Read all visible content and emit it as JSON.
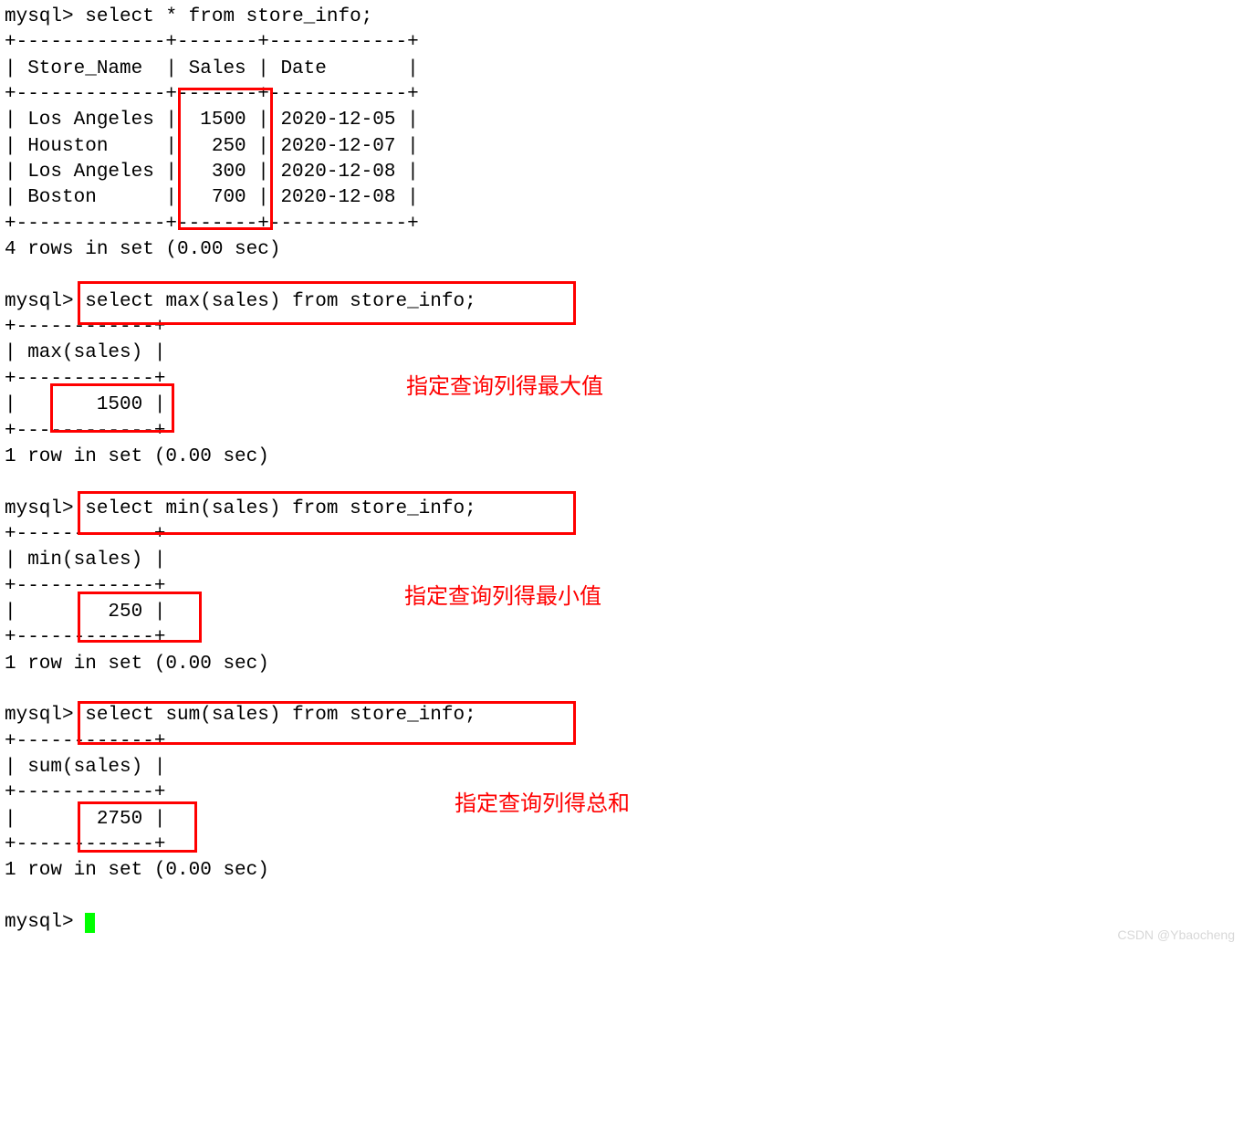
{
  "terminal": {
    "prompt": "mysql>",
    "query1": " select * from store_info;",
    "table1_border_top": "+-------------+-------+------------+",
    "table1_header": "| Store_Name  | Sales | Date       |",
    "table1_border_mid": "+-------------+-------+------------+",
    "table1_row1": "| Los Angeles |  1500 | 2020-12-05 |",
    "table1_row2": "| Houston     |   250 | 2020-12-07 |",
    "table1_row3": "| Los Angeles |   300 | 2020-12-08 |",
    "table1_row4": "| Boston      |   700 | 2020-12-08 |",
    "table1_border_bot": "+-------------+-------+------------+",
    "result1": "4 rows in set (0.00 sec)",
    "blank": "",
    "query2": " select max(sales) from store_info;",
    "table2_border_top": "+------------+",
    "table2_header": "| max(sales) |",
    "table2_border_mid": "+------------+",
    "table2_row1": "|       1500 |",
    "table2_border_bot": "+------------+",
    "result2": "1 row in set (0.00 sec)",
    "query3": " select min(sales) from store_info;",
    "table3_border_top": "+------------+",
    "table3_header": "| min(sales) |",
    "table3_border_mid": "+------------+",
    "table3_row1": "|        250 |",
    "table3_border_bot": "+------------+",
    "result3": "1 row in set (0.00 sec)",
    "query4": " select sum(sales) from store_info;",
    "table4_border_top": "+------------+",
    "table4_header": "| sum(sales) |",
    "table4_border_mid": "+------------+",
    "table4_row1": "|       2750 |",
    "table4_border_bot": "+------------+",
    "result4": "1 row in set (0.00 sec)",
    "final_prompt": "mysql> "
  },
  "annotations": {
    "label_max": "指定查询列得最大值",
    "label_min": "指定查询列得最小值",
    "label_sum": "指定查询列得总和"
  },
  "watermark": "CSDN @Ybaocheng"
}
